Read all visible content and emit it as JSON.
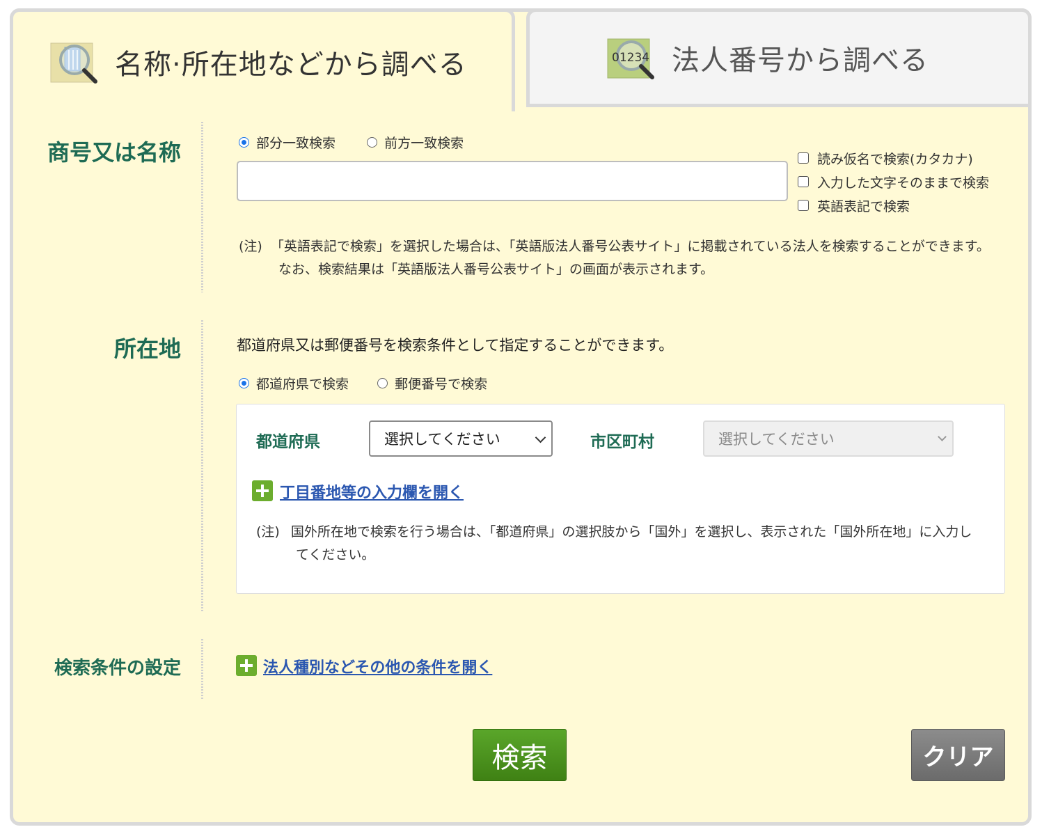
{
  "tabs": [
    {
      "label": "名称·所在地などから調べる",
      "icon": "magnifier-building-icon",
      "active": true
    },
    {
      "label": "法人番号から調べる",
      "icon": "magnifier-number-icon",
      "icon_text": "01234",
      "active": false
    }
  ],
  "name_section": {
    "label": "商号又は名称",
    "radios": [
      {
        "label": "部分一致検索",
        "checked": true
      },
      {
        "label": "前方一致検索",
        "checked": false
      }
    ],
    "input_value": "",
    "checkboxes": [
      {
        "label": "読み仮名で検索(カタカナ)",
        "checked": false
      },
      {
        "label": "入力した文字そのままで検索",
        "checked": false
      },
      {
        "label": "英語表記で検索",
        "checked": false
      }
    ],
    "note_prefix": "(注)",
    "note_line1": "「英語表記で検索」を選択した場合は、「英語版法人番号公表サイト」に掲載されている法人を検索することができます。",
    "note_line2": "なお、検索結果は「英語版法人番号公表サイト」の画面が表示されます。"
  },
  "location_section": {
    "label": "所在地",
    "description": "都道府県又は郵便番号を検索条件として指定することができます。",
    "radios": [
      {
        "label": "都道府県で検索",
        "checked": true
      },
      {
        "label": "郵便番号で検索",
        "checked": false
      }
    ],
    "prefecture_label": "都道府県",
    "prefecture_value": "選択してください",
    "city_label": "市区町村",
    "city_value": "選択してください",
    "expand_link": "丁目番地等の入力欄を開く",
    "note_prefix": "(注)",
    "note_line1": "国外所在地で検索を行う場合は、「都道府県」の選択肢から「国外」を選択し、表示された「国外所在地」に入力し",
    "note_line2": "てください。"
  },
  "conditions_section": {
    "label": "検索条件の設定",
    "expand_link": "法人種別などその他の条件を開く"
  },
  "buttons": {
    "search": "検索",
    "clear": "クリア"
  },
  "colors": {
    "panel_bg": "#fffad6",
    "label_green": "#1e6b54",
    "link_blue": "#2b57b0",
    "search_button": "#4a8f1c",
    "clear_button": "#7a7a7a",
    "plus_green": "#6cad2e"
  }
}
